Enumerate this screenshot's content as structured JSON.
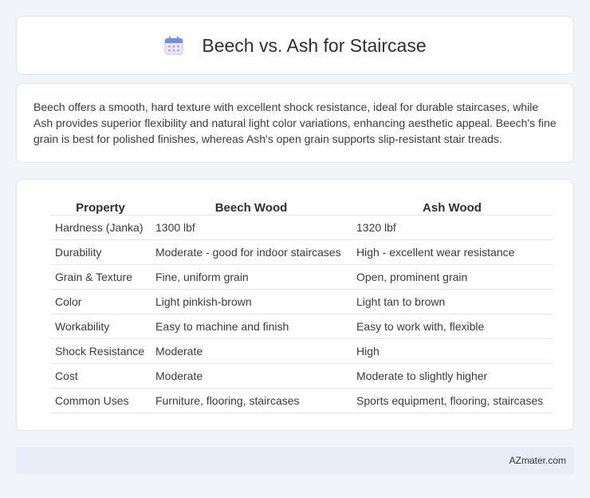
{
  "header": {
    "title": "Beech vs. Ash for Staircase",
    "icon": "calendar-icon"
  },
  "summary": {
    "text": "Beech offers a smooth, hard texture with excellent shock resistance, ideal for durable staircases, while Ash provides superior flexibility and natural light color variations, enhancing aesthetic appeal. Beech's fine grain is best for polished finishes, whereas Ash's open grain supports slip-resistant stair treads."
  },
  "table": {
    "headers": [
      "Property",
      "Beech Wood",
      "Ash Wood"
    ],
    "rows": [
      [
        "Hardness (Janka)",
        "1300 lbf",
        "1320 lbf"
      ],
      [
        "Durability",
        "Moderate - good for indoor staircases",
        "High - excellent wear resistance"
      ],
      [
        "Grain & Texture",
        "Fine, uniform grain",
        "Open, prominent grain"
      ],
      [
        "Color",
        "Light pinkish-brown",
        "Light tan to brown"
      ],
      [
        "Workability",
        "Easy to machine and finish",
        "Easy to work with, flexible"
      ],
      [
        "Shock Resistance",
        "Moderate",
        "High"
      ],
      [
        "Cost",
        "Moderate",
        "Moderate to slightly higher"
      ],
      [
        "Common Uses",
        "Furniture, flooring, staircases",
        "Sports equipment, flooring, staircases"
      ]
    ]
  },
  "footer": {
    "text": "AZmater.com"
  },
  "colors": {
    "background": "#f1f4f9",
    "footer_bg": "#e8edf7",
    "card_border": "#dde3ec"
  }
}
